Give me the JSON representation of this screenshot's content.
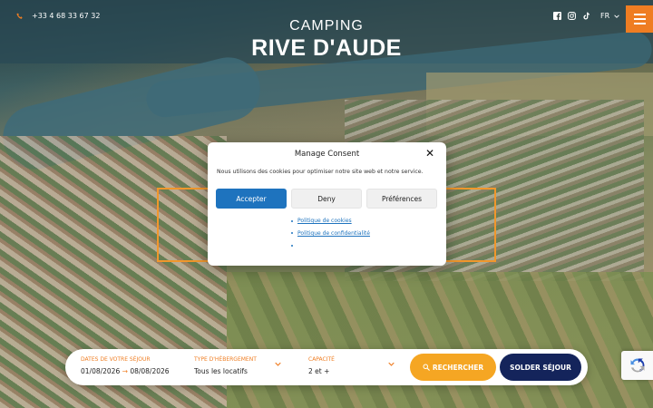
{
  "header": {
    "phone": "+33 4 68 33 67 32",
    "language": "FR",
    "social_icons": [
      "facebook-icon",
      "instagram-icon",
      "tiktok-icon"
    ],
    "menu_icon": "hamburger-icon"
  },
  "brand": {
    "line1": "CAMPING",
    "line2": "RIVE D'AUDE"
  },
  "consent": {
    "title": "Manage Consent",
    "text": "Nous utilisons des cookies pour optimiser notre site web et notre service.",
    "accept_label": "Accepter",
    "deny_label": "Deny",
    "preferences_label": "Préférences",
    "links": [
      "Politique de cookies",
      "Politique de confidentialité"
    ]
  },
  "booking": {
    "dates_label": "DATES DE VOTRE SÉJOUR",
    "date_from": "01/08/2026",
    "date_to": "08/08/2026",
    "type_label": "TYPE D'HÉBERGEMENT",
    "type_value": "Tous les locatifs",
    "capacity_label": "CAPACITÉ",
    "capacity_value": "2 et +",
    "search_label": "RECHERCHER",
    "pay_label": "SOLDER SÉJOUR"
  },
  "colors": {
    "accent": "#ef7d22",
    "primary_button": "#1e73be",
    "navy": "#14245b",
    "search_button": "#f5a623"
  }
}
